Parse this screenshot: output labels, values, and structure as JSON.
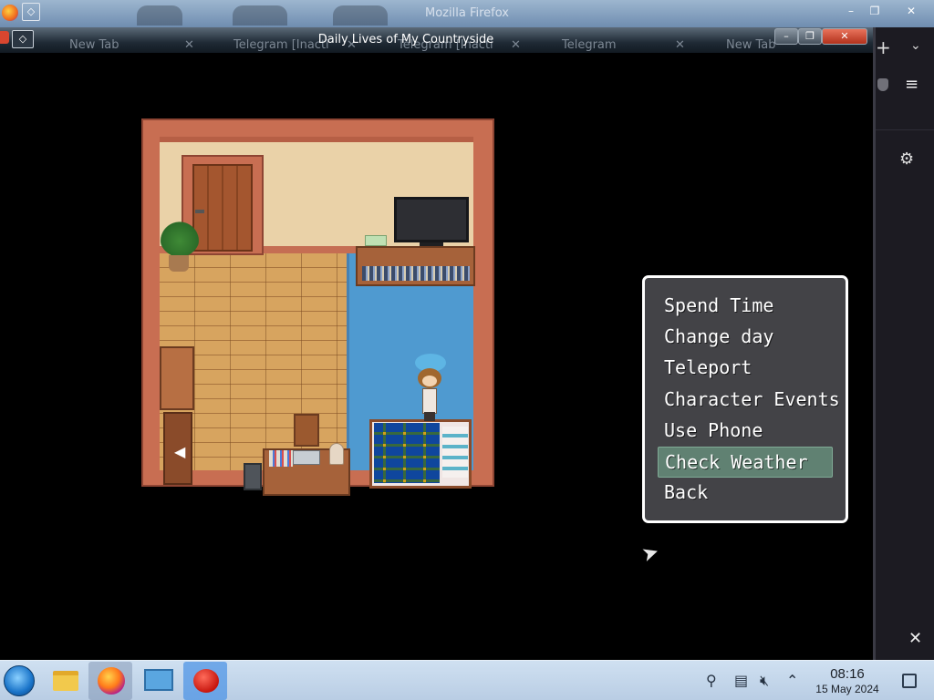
{
  "browser": {
    "title": "Mozilla Firefox",
    "controls": [
      "–",
      "❐",
      "✕"
    ],
    "side": {
      "new_tab": "+",
      "tab_list": "⌄",
      "menu": "≡",
      "settings": "⚙",
      "close": "✕"
    }
  },
  "game_window": {
    "title": "Daily Lives of My Countryside",
    "background_tabs": [
      "New Tab",
      "Telegram [Inacti",
      "Telegram [Inacti",
      "Telegram",
      "New Tab"
    ],
    "controls": [
      "–",
      "❐",
      "✕"
    ]
  },
  "scene": {
    "nav_arrow": "◀"
  },
  "menu": {
    "items": [
      "Spend Time",
      "Change day",
      "Teleport",
      "Character Events",
      "Use Phone",
      "Check Weather",
      "Back"
    ],
    "selected": "Check Weather"
  },
  "taskbar": {
    "time": "08:16",
    "date": "15 May 2024"
  },
  "colors": {
    "menu_bg": "#46464a",
    "menu_border": "#ffffff",
    "menu_highlight": "#78b496",
    "taskbar": "#c5d8ec"
  }
}
